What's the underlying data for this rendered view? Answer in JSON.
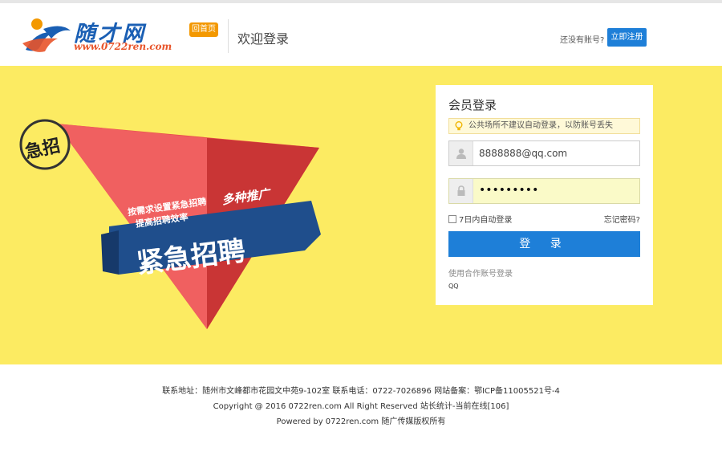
{
  "header": {
    "logo_title": "随才网",
    "logo_url": "www.0722ren.com",
    "home_label": "回首页",
    "welcome": "欢迎登录",
    "no_account": "还没有账号?",
    "register_label": "立即注册"
  },
  "banner": {
    "seal_text": "急招",
    "line1": "按需求设置紧急招聘",
    "line2": "提高招聘效率",
    "slogan": "多种推广",
    "ribbon": "紧急招聘"
  },
  "login": {
    "title": "会员登录",
    "tip": "公共场所不建议自动登录，以防账号丢失",
    "username": "8888888@qq.com",
    "password": "•••••••••",
    "remember": "7日内自动登录",
    "forgot": "忘记密码?",
    "submit": "登 录",
    "partner_label": "使用合作账号登录",
    "qq": "QQ"
  },
  "footer": {
    "line1": "联系地址：随州市文峰都市花园文中苑9-102室 联系电话：0722-7026896 网站备案：鄂ICP备11005521号-4",
    "line2": "Copyright @ 2016 0722ren.com All Right Reserved 站长统计-当前在线[106]",
    "line3": "Powered by 0722ren.com 随广传媒版权所有"
  },
  "colors": {
    "accent": "#1e7fd8",
    "banner_bg": "#fceb62",
    "promo_red": "#e84a4a",
    "ribbon_blue": "#1f4e8c"
  }
}
